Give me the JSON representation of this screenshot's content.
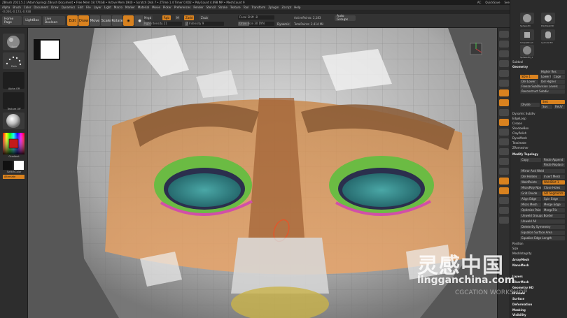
{
  "titlebar": {
    "app_title": "ZBrush 2021.5.1 [Adam Spring]  ZBrush Document  • Free Mem 18.774GB • Active Mem 1940 • Scratch Disk 7 • ZTime 1.4 Timer 0.002 • PolyCount 4.698 MP • MeshCount 9",
    "ac": "AC",
    "quicksave": "QuickSave",
    "see_through": "See-through  0",
    "menus": "Menus",
    "default_zscript": "DefaultZScript"
  },
  "menubar": {
    "items": [
      "Alpha",
      "Brush",
      "Color",
      "Document",
      "Draw",
      "Dynamics",
      "Edit",
      "File",
      "Layer",
      "Light",
      "Macro",
      "Marker",
      "Material",
      "Movie",
      "Picker",
      "Preferences",
      "Render",
      "Stencil",
      "Stroke",
      "Texture",
      "Tool",
      "Transform",
      "Zplugin",
      "Zscript",
      "Help"
    ]
  },
  "inforow": {
    "text": "-0.066,-0.173,-0.938"
  },
  "shelf": {
    "home_page": "Home Page",
    "lightbox": "LightBox",
    "live_boolean": "Live Boolean",
    "edit": "Edit",
    "draw": "Draw",
    "move": "Move",
    "scale": "Scale",
    "rotate": "Rotate",
    "mrgb": "Mrgb",
    "rgb": "Rgb",
    "m": "M",
    "zadd": "Zadd",
    "zsub": "Zsub",
    "rgb_intensity": "Rgb Intensity 21",
    "z_intensity": "Z Intensity 9",
    "focal_shift": "Focal Shift -8",
    "draw_size": "Draw Size 30 DYN",
    "dynamic": "Dynamic",
    "active_points": "ActivePoints: 2,183",
    "total_points": "TotalPoints: 2.414 Mil",
    "auto_groups": "Auto Groups"
  },
  "leftshelf": {
    "brush": "Move",
    "stroke": "Dots",
    "alpha": "Alpha Off",
    "texture": "Texture Off",
    "material": "",
    "gradient": "Gradient",
    "switch_color": "SwitchColor",
    "alternate": "Alternate"
  },
  "rightpanel": {
    "subtool_label": "Sphere3D",
    "subtool_items": [
      "Sphere3D",
      "PolyMesh3D",
      "SimpleBrush",
      "Cylinder3D",
      "Sphere3D_1"
    ],
    "select": "Subtool",
    "geometry_header": "Geometry",
    "higher_res": "Higher Res",
    "lower_res": "Lower Res",
    "sdiv": "SDiv 1",
    "cage": "Cage",
    "rstr": "Rstr",
    "del_lower": "Del Lower",
    "del_higher": "Del Higher",
    "freeze_subdiv": "Freeze SubDivision Levels",
    "reconstruct": "Reconstruct Subdiv",
    "divide": "Divide",
    "smt": "Smt",
    "suv": "Suv",
    "reuv": "ReUV",
    "dynamic_subdiv": "Dynamic Subdiv",
    "edgeloop": "EdgeLoop",
    "crease": "Crease",
    "shadowbox": "ShadowBox",
    "claypolish": "ClayPolish",
    "dynamesh": "DynaMesh",
    "tessimate": "Tessimate",
    "zremesher": "ZRemesher",
    "modify_topology": "Modify Topology",
    "copy": "Copy",
    "paste_append": "Paste Append",
    "paste_replace": "Paste Replace",
    "mirror_and_weld": "Mirror And Weld",
    "del_hidden": "Del Hidden",
    "insert_mesh": "Insert Mesh",
    "weldpoints": "WeldPoints",
    "weld_dist": "WeldDist 1",
    "micropoly": "MicroPoly None",
    "close_holes": "Close Holes",
    "grid_divide": "Grid Divide",
    "gd_segments": "GD Segments 3",
    "align_edge": "Align Edge",
    "spin_edge": "Spin Edge",
    "micro_mesh": "Micro Mesh",
    "merge_edge": "Merge Edge",
    "optimize_points": "Optimize Points",
    "merge_tris": "MergeTris",
    "unweld_groups_border": "Unweld Groups Border",
    "unweld_all": "Unweld All",
    "delete_by_symmetry": "Delete By Symmetry",
    "equalize_surface_area": "Equalize Surface Area",
    "equalize_edge_length": "Equalize Edge Length",
    "position": "Position",
    "size": "Size",
    "mesh_integrity": "MeshIntegrity",
    "arraymesh": "ArrayMesh",
    "nanomesh": "NanoMesh",
    "layers": "Layers",
    "fibermesh": "FiberMesh",
    "geometry_hd": "Geometry HD",
    "preview": "Preview",
    "surface": "Surface",
    "deformation": "Deformation",
    "masking": "Masking",
    "visibility": "Visibility"
  },
  "watermark": {
    "cn_text": "灵感中国",
    "url": "lingganchina.com",
    "sub": "CGCATION WORKSHOP"
  },
  "colors": {
    "accent": "#d9821f",
    "panel": "#2b2b2b",
    "viewport": "#575757"
  }
}
